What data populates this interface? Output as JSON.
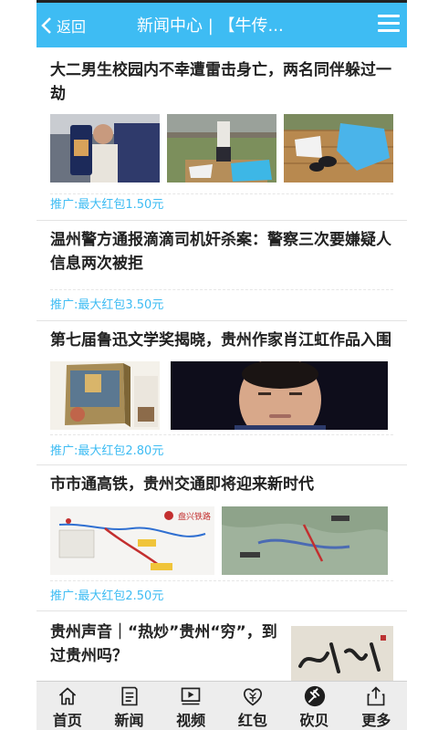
{
  "header": {
    "back_label": "返回",
    "title": "新闻中心 | 【牛传...",
    "accent": "#3ebcf3"
  },
  "feed": [
    {
      "headline_line1": "大二男生校园内不幸遭雷击身亡，两名同伴躲过一",
      "headline_line2": "劫",
      "promo": "推广:最大红包1.50元"
    },
    {
      "headline_line1": "温州警方通报滴滴司机奸杀案：警察三次要嫌疑人",
      "headline_line2": "信息两次被拒",
      "promo": "推广:最大红包3.50元"
    },
    {
      "headline_line1": "第七届鲁迅文学奖揭晓，贵州作家肖江虹作品入围",
      "promo": "推广:最大红包2.80元"
    },
    {
      "headline_line1": "市市通高铁，贵州交通即将迎来新时代",
      "promo": "推广:最大红包2.50元",
      "map_label": "盘兴铁路"
    },
    {
      "headline_line1": "贵州声音｜“热炒”贵州“穷”，到",
      "headline_line2": "过贵州吗？"
    }
  ],
  "tabbar": [
    {
      "label": "首页",
      "icon": "home-icon"
    },
    {
      "label": "新闻",
      "icon": "news-icon"
    },
    {
      "label": "视频",
      "icon": "video-icon"
    },
    {
      "label": "红包",
      "icon": "redpacket-icon"
    },
    {
      "label": "砍贝",
      "icon": "auction-icon"
    },
    {
      "label": "更多",
      "icon": "share-icon"
    }
  ]
}
